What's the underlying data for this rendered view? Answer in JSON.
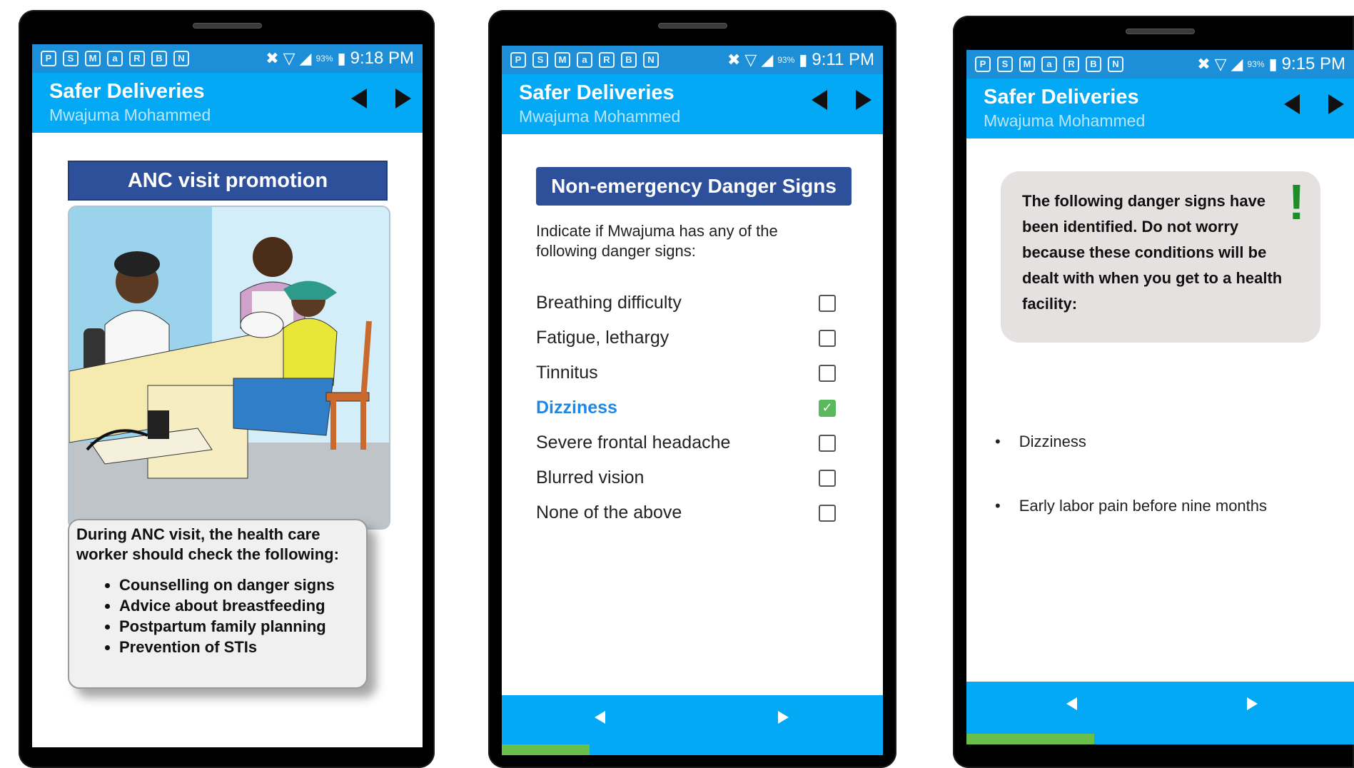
{
  "status": {
    "icons": [
      "P",
      "S",
      "M",
      "a",
      "R",
      "B",
      "N"
    ],
    "battery": "93%",
    "signal_icons": [
      "mute-icon",
      "wifi-icon",
      "signal-icon",
      "battery-icon"
    ]
  },
  "app": {
    "title": "Safer Deliveries",
    "subtitle": "Mwajuma Mohammed"
  },
  "screens": [
    {
      "time": "9:18 PM",
      "banner": "ANC visit promotion",
      "card_intro": "During ANC visit, the health care worker should check the following:",
      "card_items": [
        "Counselling on danger signs",
        "Advice about breastfeeding",
        "Postpartum family planning",
        "Prevention of STIs"
      ]
    },
    {
      "time": "9:11 PM",
      "banner": "Non-emergency Danger Signs",
      "prompt": "Indicate if Mwajuma has any of the following danger signs:",
      "options": [
        {
          "label": "Breathing difficulty",
          "checked": false
        },
        {
          "label": "Fatigue, lethargy",
          "checked": false
        },
        {
          "label": "Tinnitus",
          "checked": false
        },
        {
          "label": "Dizziness",
          "checked": true
        },
        {
          "label": "Severe frontal headache",
          "checked": false
        },
        {
          "label": "Blurred vision",
          "checked": false
        },
        {
          "label": "None of the above",
          "checked": false
        }
      ],
      "progress": 0.23
    },
    {
      "time": "9:15 PM",
      "bubble_text": "The following danger signs have been identified. Do not worry because these conditions will be dealt with when you get to a health facility:",
      "exclamation": "!",
      "signs": [
        "Dizziness",
        "Early labor pain before nine months"
      ],
      "progress": 0.33
    }
  ],
  "colors": {
    "statusbar": "#1d8fd8",
    "appbar": "#03a9f4",
    "banner": "#2e4f9a",
    "progress": "#6abf4b",
    "check": "#5cb85c",
    "highlight": "#1e88e5"
  }
}
